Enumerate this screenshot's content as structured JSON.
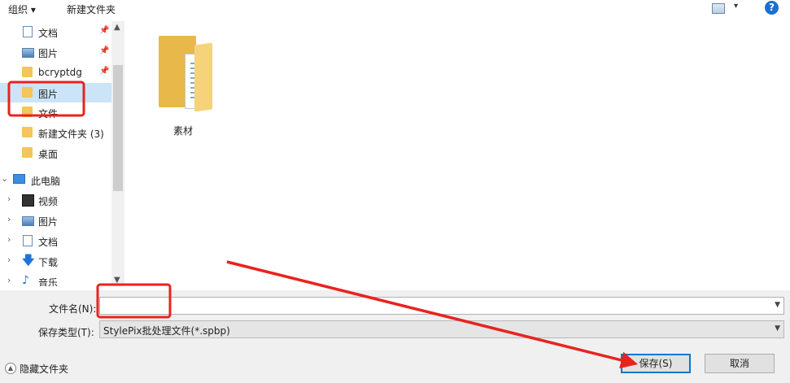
{
  "toolbar": {
    "organize": "组织 ▾",
    "new_folder": "新建文件夹",
    "view_menu_arrow": "▾",
    "help": "?"
  },
  "nav": {
    "quick_access": [
      {
        "label": "文档",
        "icon": "document-icon",
        "pinned": true
      },
      {
        "label": "图片",
        "icon": "pictures-icon",
        "pinned": true
      },
      {
        "label": "bcryptdg",
        "icon": "folder-icon",
        "pinned": true
      },
      {
        "label": "图片",
        "icon": "folder-icon",
        "pinned": false,
        "selected": true
      },
      {
        "label": "文件",
        "icon": "folder-icon",
        "pinned": false
      },
      {
        "label": "新建文件夹 (3)",
        "icon": "folder-icon",
        "pinned": false
      },
      {
        "label": "桌面",
        "icon": "folder-icon",
        "pinned": false
      }
    ],
    "this_pc": {
      "label": "此电脑",
      "icon": "computer-icon"
    },
    "pc_items": [
      {
        "label": "视频",
        "icon": "video-icon"
      },
      {
        "label": "图片",
        "icon": "pictures-icon"
      },
      {
        "label": "文档",
        "icon": "document-icon"
      },
      {
        "label": "下载",
        "icon": "download-icon"
      },
      {
        "label": "音乐",
        "icon": "music-icon"
      }
    ]
  },
  "content": {
    "files": [
      {
        "name": "素材",
        "icon": "folder-icon"
      }
    ]
  },
  "form": {
    "filename_label": "文件名(N):",
    "filename_value": "",
    "filetype_label": "保存类型(T):",
    "filetype_value": "StylePix批处理文件(*.spbp)"
  },
  "footer": {
    "hide_folders": "隐藏文件夹",
    "save": "保存(S)",
    "cancel": "取消"
  },
  "annotation_color": "#e8231e"
}
